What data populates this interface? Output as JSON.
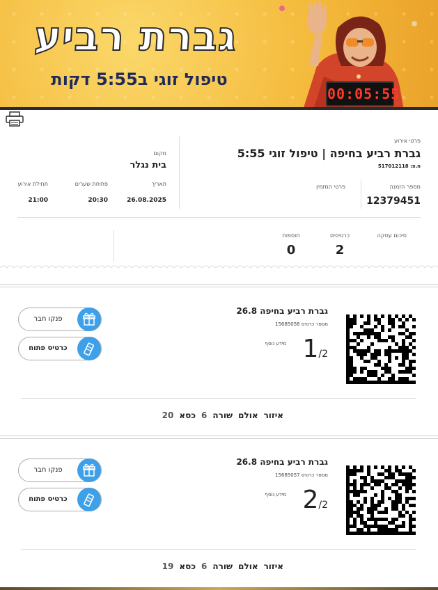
{
  "banner": {
    "title": "גברת רביע",
    "subtitle": "טיפול זוגי ב5:55 דקות",
    "timer": "00:05:55"
  },
  "event": {
    "label": "פרטי אירוע",
    "title": "גברת רביע בחיפה | טיפול זוגי 5:55",
    "code": "ח.פ: 517012118",
    "place_label": "מקום",
    "place": "בית נגלר",
    "date_label": "תאריך",
    "date": "26.08.2025",
    "gates_label": "פתיחת שערים",
    "gates": "20:30",
    "start_label": "תחילת אירוע",
    "start": "21:00",
    "order_label": "מספר הזמנה",
    "order_number": "12379451",
    "orderer_label": "פרטי המזמין"
  },
  "summary": {
    "label": "סיכום עסקה",
    "tickets_label": "כרטיסים",
    "tickets": "2",
    "extras_label": "תוספות",
    "extras": "0"
  },
  "tickets": [
    {
      "title": "גברת רביע בחיפה 26.8",
      "number_label": "מספר כרטיס 15685056",
      "info_label": "מידע נוסף",
      "index": "1",
      "total": "/2",
      "pamper_label": "פנקו חבר",
      "open_label": "כרטיס פתוח",
      "area_label": "איזור",
      "area": "אולם",
      "row_label": "שורה",
      "row": "6",
      "seat_label": "כסא",
      "seat": "20"
    },
    {
      "title": "גברת רביע בחיפה 26.8",
      "number_label": "מספר כרטיס 15685057",
      "info_label": "מידע נוסף",
      "index": "2",
      "total": "/2",
      "pamper_label": "פנקו חבר",
      "open_label": "כרטיס פתוח",
      "area_label": "איזור",
      "area": "אולם",
      "row_label": "שורה",
      "row": "6",
      "seat_label": "כסא",
      "seat": "19"
    }
  ],
  "icons": {
    "print": "printer-icon",
    "gift": "gift-icon",
    "open": "open-ticket-icon"
  },
  "colors": {
    "accent": "#3da0e8",
    "banner": "#f4b93a"
  }
}
